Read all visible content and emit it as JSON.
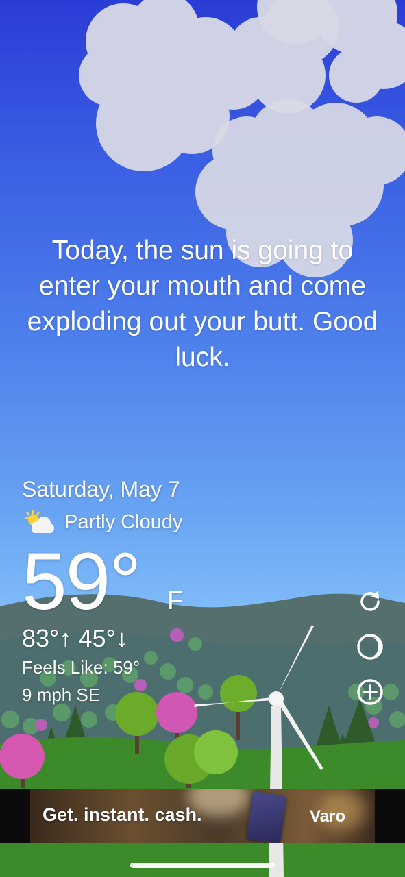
{
  "message": "Today, the sun is going to enter your mouth and come exploding out your butt. Good luck.",
  "weather": {
    "date": "Saturday, May 7",
    "condition": "Partly Cloudy",
    "condition_icon": "partly-cloudy-icon",
    "temperature": "59°",
    "unit": "F",
    "high_low": "83°↑ 45°↓",
    "feels_like": "Feels Like: 59°",
    "wind": "9 mph SE"
  },
  "side_buttons": [
    {
      "name": "refresh",
      "icon": "refresh-icon"
    },
    {
      "name": "theme",
      "icon": "moon-icon"
    },
    {
      "name": "add-location",
      "icon": "plus-circle-icon"
    }
  ],
  "ad": {
    "headline": "Get. instant. cash.",
    "brand": "Varo",
    "choice_icon": "ad-choices-icon"
  },
  "colors": {
    "sky_top": "#2a3cd6",
    "sky_bottom": "#86c2f8",
    "hills": "#4d6e6e",
    "grass": "#3f8c2c",
    "tree_pink": "#d45ab0",
    "tree_green": "#6cae2c"
  }
}
